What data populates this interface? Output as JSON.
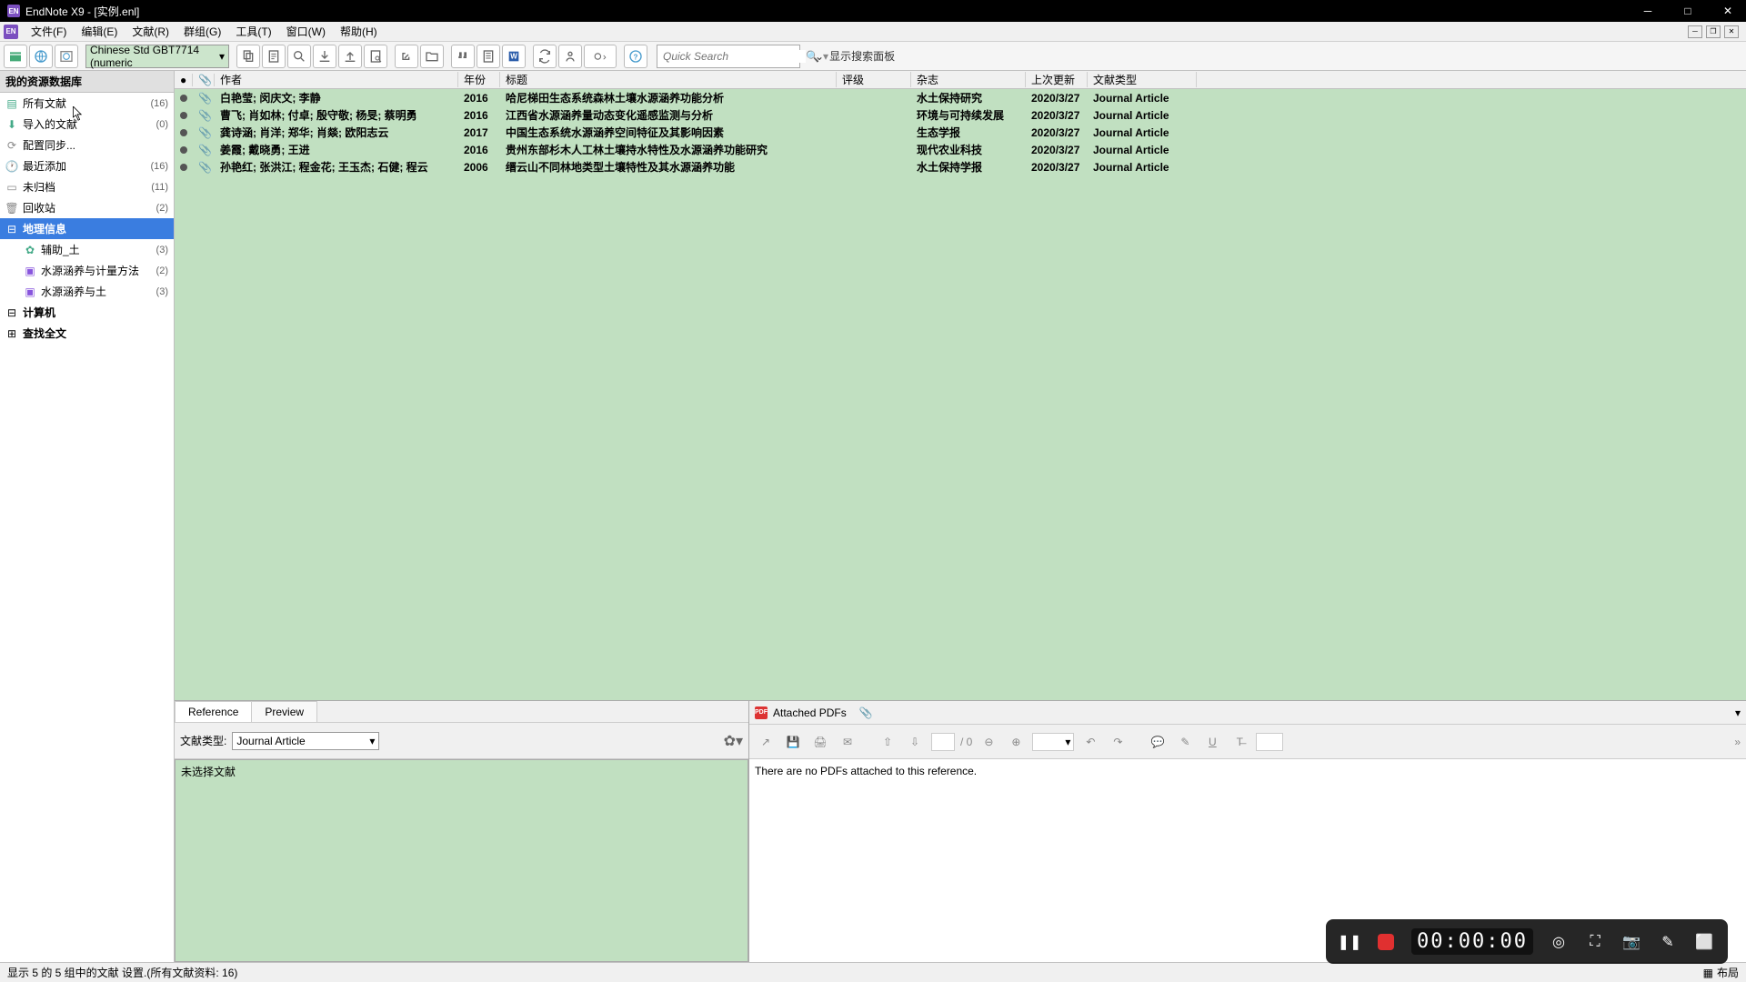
{
  "window": {
    "title": "EndNote X9 - [实例.enl]"
  },
  "menu": {
    "file": "文件(F)",
    "edit": "编辑(E)",
    "ref": "文献(R)",
    "group": "群组(G)",
    "tools": "工具(T)",
    "window": "窗口(W)",
    "help": "帮助(H)"
  },
  "toolbar": {
    "style": "Chinese Std GBT7714 (numeric",
    "search_placeholder": "Quick Search",
    "show_search": "显示搜索面板"
  },
  "sidebar": {
    "header": "我的资源数据库",
    "items": [
      {
        "label": "所有文献",
        "count": "(16)"
      },
      {
        "label": "导入的文献",
        "count": "(0)"
      },
      {
        "label": "配置同步...",
        "count": ""
      },
      {
        "label": "最近添加",
        "count": "(16)"
      },
      {
        "label": "未归档",
        "count": "(11)"
      },
      {
        "label": "回收站",
        "count": "(2)"
      }
    ],
    "group": {
      "label": "地理信息"
    },
    "subitems": [
      {
        "label": "辅助_土",
        "count": "(3)"
      },
      {
        "label": "水源涵养与计量方法",
        "count": "(2)"
      },
      {
        "label": "水源涵养与土",
        "count": "(3)"
      }
    ],
    "computer": "计算机",
    "fulltext": "查找全文"
  },
  "columns": {
    "author": "作者",
    "year": "年份",
    "title": "标题",
    "rating": "评级",
    "journal": "杂志",
    "updated": "上次更新",
    "type": "文献类型"
  },
  "rows": [
    {
      "author": "白艳莹; 闵庆文; 李静",
      "year": "2016",
      "title": "哈尼梯田生态系统森林土壤水源涵养功能分析",
      "journal": "水土保持研究",
      "updated": "2020/3/27",
      "type": "Journal Article"
    },
    {
      "author": "曹飞; 肖如林; 付卓; 殷守敬; 杨旻; 蔡明勇",
      "year": "2016",
      "title": "江西省水源涵养量动态变化遥感监测与分析",
      "journal": "环境与可持续发展",
      "updated": "2020/3/27",
      "type": "Journal Article"
    },
    {
      "author": "龚诗涵; 肖洋; 郑华; 肖燚; 欧阳志云",
      "year": "2017",
      "title": "中国生态系统水源涵养空间特征及其影响因素",
      "journal": "生态学报",
      "updated": "2020/3/27",
      "type": "Journal Article"
    },
    {
      "author": "姜霞; 戴晓勇; 王进",
      "year": "2016",
      "title": "贵州东部杉木人工林土壤持水特性及水源涵养功能研究",
      "journal": "现代农业科技",
      "updated": "2020/3/27",
      "type": "Journal Article"
    },
    {
      "author": "孙艳红; 张洪江; 程金花; 王玉杰; 石健; 程云",
      "year": "2006",
      "title": "缙云山不同林地类型土壤特性及其水源涵养功能",
      "journal": "水土保持学报",
      "updated": "2020/3/27",
      "type": "Journal Article"
    }
  ],
  "ref_panel": {
    "tab_reference": "Reference",
    "tab_preview": "Preview",
    "type_label": "文献类型:",
    "type_value": "Journal Article",
    "body": "未选择文献"
  },
  "pdf_panel": {
    "header": "Attached PDFs",
    "page_total": "/ 0",
    "body": "There are no PDFs attached to this reference."
  },
  "status": {
    "text": "显示 5 的 5 组中的文献 设置.(所有文献资料: 16)",
    "layout": "布局"
  },
  "recorder": {
    "time": "00:00:00"
  }
}
